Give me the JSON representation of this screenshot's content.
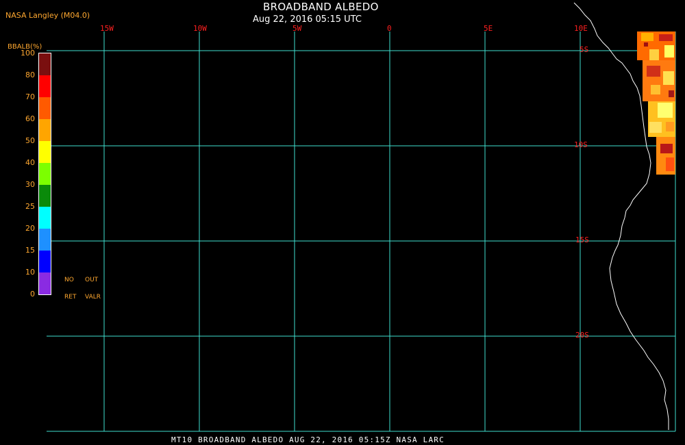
{
  "header": {
    "agency": "NASA Langley (M04.0)",
    "title": "BROADBAND ALBEDO",
    "subtitle": "Aug 22, 2016 05:15 UTC"
  },
  "legend": {
    "title": "BBALB(%)",
    "tick_labels": [
      "100",
      "80",
      "70",
      "60",
      "50",
      "40",
      "30",
      "25",
      "20",
      "15",
      "10",
      "0"
    ],
    "colors": [
      "#7a0f0f",
      "#ff0000",
      "#ff5a00",
      "#ffa500",
      "#ffff00",
      "#7cff00",
      "#0a8a0a",
      "#00ffff",
      "#1e90ff",
      "#0000ff",
      "#8a2be2"
    ],
    "notes": [
      "NO",
      "OUT",
      "RET",
      "VALR"
    ]
  },
  "grid": {
    "lon_labels": [
      "15W",
      "10W",
      "5W",
      "0",
      "5E",
      "10E"
    ],
    "lat_labels": [
      "5S",
      "10S",
      "15S",
      "20S"
    ],
    "line_color": "#40e0d0",
    "label_color": "#ff2020"
  },
  "footer": {
    "text": "MT10  BROADBAND ALBEDO   AUG 22, 2016 05:15Z   NASA LARC"
  }
}
